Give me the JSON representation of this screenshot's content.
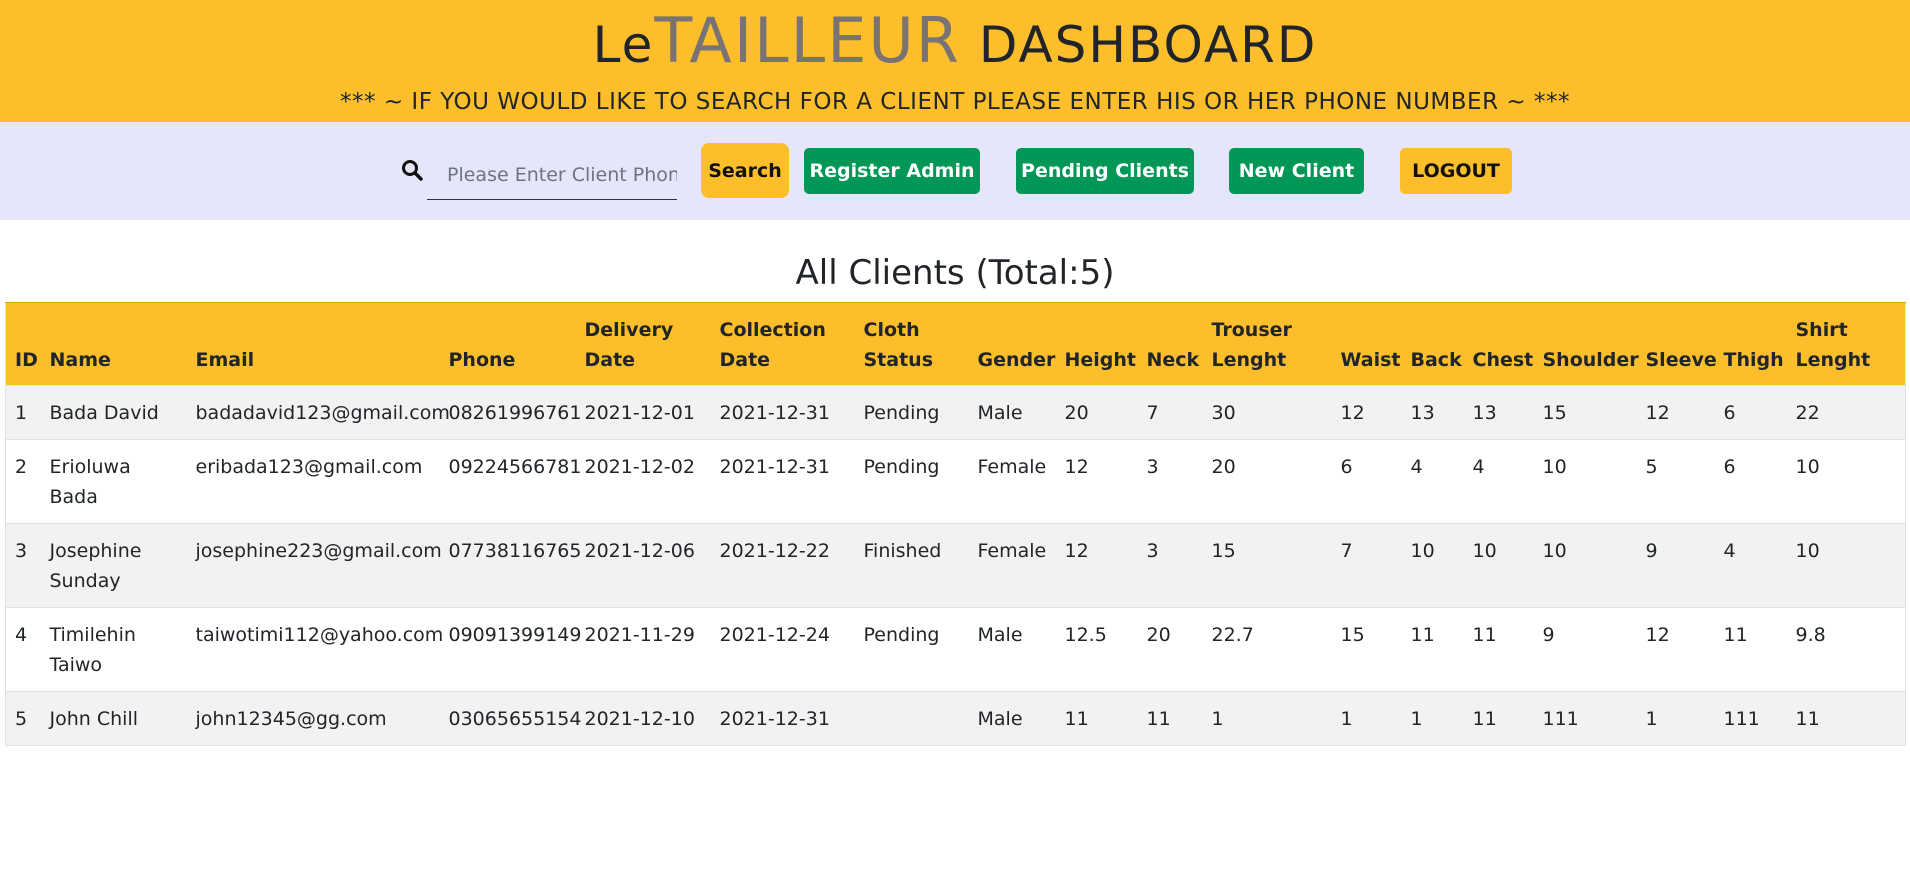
{
  "header": {
    "brand_prefix": "Le",
    "brand_highlight": "TAILLEUR",
    "brand_suffix": "DASHBOARD",
    "notice": "*** ~ IF YOU WOULD LIKE TO SEARCH FOR A CLIENT PLEASE ENTER HIS OR HER PHONE NUMBER ~ ***"
  },
  "toolbar": {
    "search_placeholder": "Please Enter Client Phone Number",
    "search_label": "Search",
    "register_admin_label": "Register Admin",
    "pending_clients_label": "Pending Clients",
    "new_client_label": "New Client",
    "logout_label": "LOGOUT"
  },
  "icons": {
    "search": "search-icon"
  },
  "colors": {
    "accent_yellow": "#fcbf2b",
    "toolbar_bg": "#e6e6fa",
    "button_green": "#009757",
    "brand_grey": "#7a7373"
  },
  "main": {
    "title": "All Clients (Total:5)",
    "columns": [
      {
        "line1": "",
        "line2": "ID"
      },
      {
        "line1": "",
        "line2": "Name"
      },
      {
        "line1": "",
        "line2": "Email"
      },
      {
        "line1": "",
        "line2": "Phone"
      },
      {
        "line1": "Delivery",
        "line2": "Date"
      },
      {
        "line1": "Collection",
        "line2": "Date"
      },
      {
        "line1": "Cloth",
        "line2": "Status"
      },
      {
        "line1": "",
        "line2": "Gender"
      },
      {
        "line1": "",
        "line2": "Height"
      },
      {
        "line1": "",
        "line2": "Neck"
      },
      {
        "line1": "Trouser",
        "line2": "Lenght"
      },
      {
        "line1": "",
        "line2": "Waist"
      },
      {
        "line1": "",
        "line2": "Back"
      },
      {
        "line1": "",
        "line2": "Chest"
      },
      {
        "line1": "",
        "line2": "Shoulder"
      },
      {
        "line1": "",
        "line2": "Sleeve"
      },
      {
        "line1": "",
        "line2": "Thigh"
      },
      {
        "line1": "Shirt",
        "line2": "Lenght"
      }
    ],
    "rows": [
      [
        "1",
        "Bada David",
        "badadavid123@gmail.com",
        "08261996761",
        "2021-12-01",
        "2021-12-31",
        "Pending",
        "Male",
        "20",
        "7",
        "30",
        "12",
        "13",
        "13",
        "15",
        "12",
        "6",
        "22"
      ],
      [
        "2",
        "Erioluwa Bada",
        "eribada123@gmail.com",
        "09224566781",
        "2021-12-02",
        "2021-12-31",
        "Pending",
        "Female",
        "12",
        "3",
        "20",
        "6",
        "4",
        "4",
        "10",
        "5",
        "6",
        "10"
      ],
      [
        "3",
        "Josephine Sunday",
        "josephine223@gmail.com",
        "07738116765",
        "2021-12-06",
        "2021-12-22",
        "Finished",
        "Female",
        "12",
        "3",
        "15",
        "7",
        "10",
        "10",
        "10",
        "9",
        "4",
        "10"
      ],
      [
        "4",
        "Timilehin Taiwo",
        "taiwotimi112@yahoo.com",
        "09091399149",
        "2021-11-29",
        "2021-12-24",
        "Pending",
        "Male",
        "12.5",
        "20",
        "22.7",
        "15",
        "11",
        "11",
        "9",
        "12",
        "11",
        "9.8"
      ],
      [
        "5",
        "John Chill",
        "john12345@gg.com",
        "03065655154",
        "2021-12-10",
        "2021-12-31",
        "",
        "Male",
        "11",
        "11",
        "1",
        "1",
        "1",
        "11",
        "111",
        "1",
        "111",
        "11"
      ]
    ]
  }
}
